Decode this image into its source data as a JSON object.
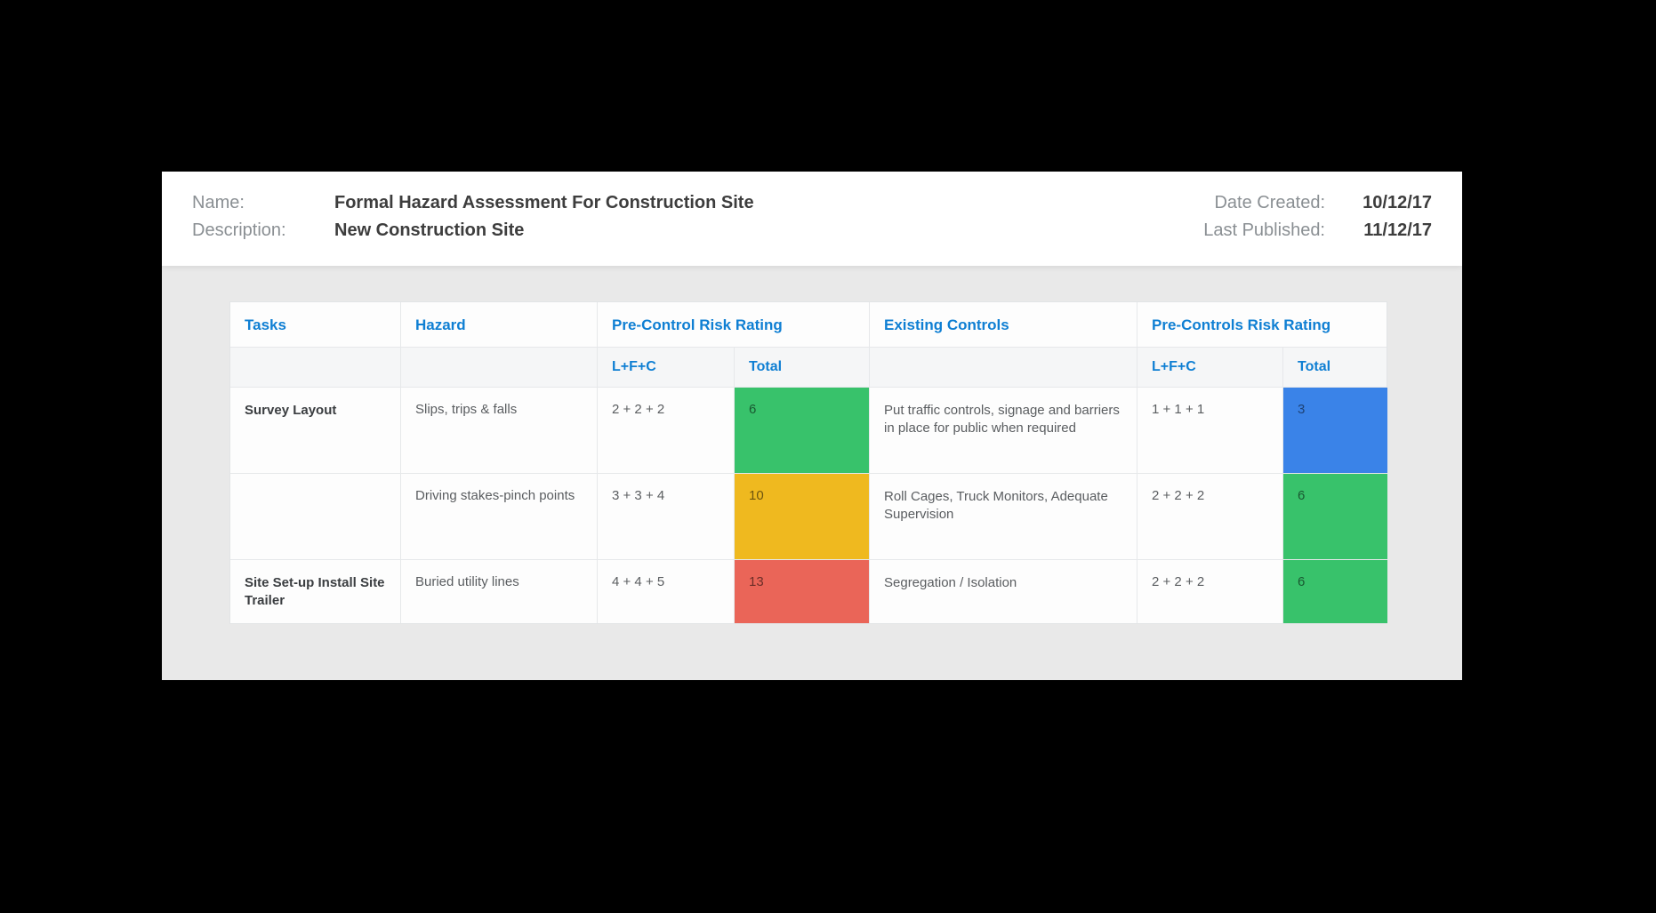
{
  "header": {
    "name_label": "Name:",
    "name_value": "Formal Hazard Assessment For Construction Site",
    "desc_label": "Description:",
    "desc_value": "New Construction Site",
    "date_created_label": "Date Created:",
    "date_created_value": "10/12/17",
    "last_pub_label": "Last Published:",
    "last_pub_value": "11/12/17"
  },
  "colors": {
    "green": "#38c26b",
    "amber": "#efb91f",
    "red": "#ea6558",
    "blue": "#3a83e8",
    "link": "#0f7fd3"
  },
  "table": {
    "headers": {
      "tasks": "Tasks",
      "hazard": "Hazard",
      "pre_control": "Pre-Control Risk Rating",
      "existing": "Existing Controls",
      "pre_controls2": "Pre-Controls Risk Rating"
    },
    "subheaders": {
      "lfc": "L+F+C",
      "total": "Total"
    },
    "rows": [
      {
        "task": "Survey Layout",
        "hazard": "Slips, trips & falls",
        "lfc1": "2 + 2 + 2",
        "total1": "6",
        "total1_class": "total-cell bg-green",
        "controls": "Put traffic controls, signage and barriers in place for public when required",
        "lfc2": "1 + 1 + 1",
        "total2": "3",
        "total2_class": "total-cell bg-blue"
      },
      {
        "task": "",
        "hazard": "Driving stakes-pinch points",
        "lfc1": "3 + 3 + 4",
        "total1": "10",
        "total1_class": "total-cell bg-amber",
        "controls": "Roll Cages, Truck Monitors, Adequate Supervision",
        "lfc2": "2 + 2 + 2",
        "total2": "6",
        "total2_class": "total-cell bg-green"
      },
      {
        "task": "Site Set-up Install Site Trailer",
        "hazard": "Buried utility lines",
        "lfc1": "4 + 4 + 5",
        "total1": "13",
        "total1_class": "total-cell bg-red",
        "controls": "Segregation / Isolation",
        "lfc2": "2 + 2 + 2",
        "total2": "6",
        "total2_class": "total-cell bg-green"
      }
    ]
  }
}
